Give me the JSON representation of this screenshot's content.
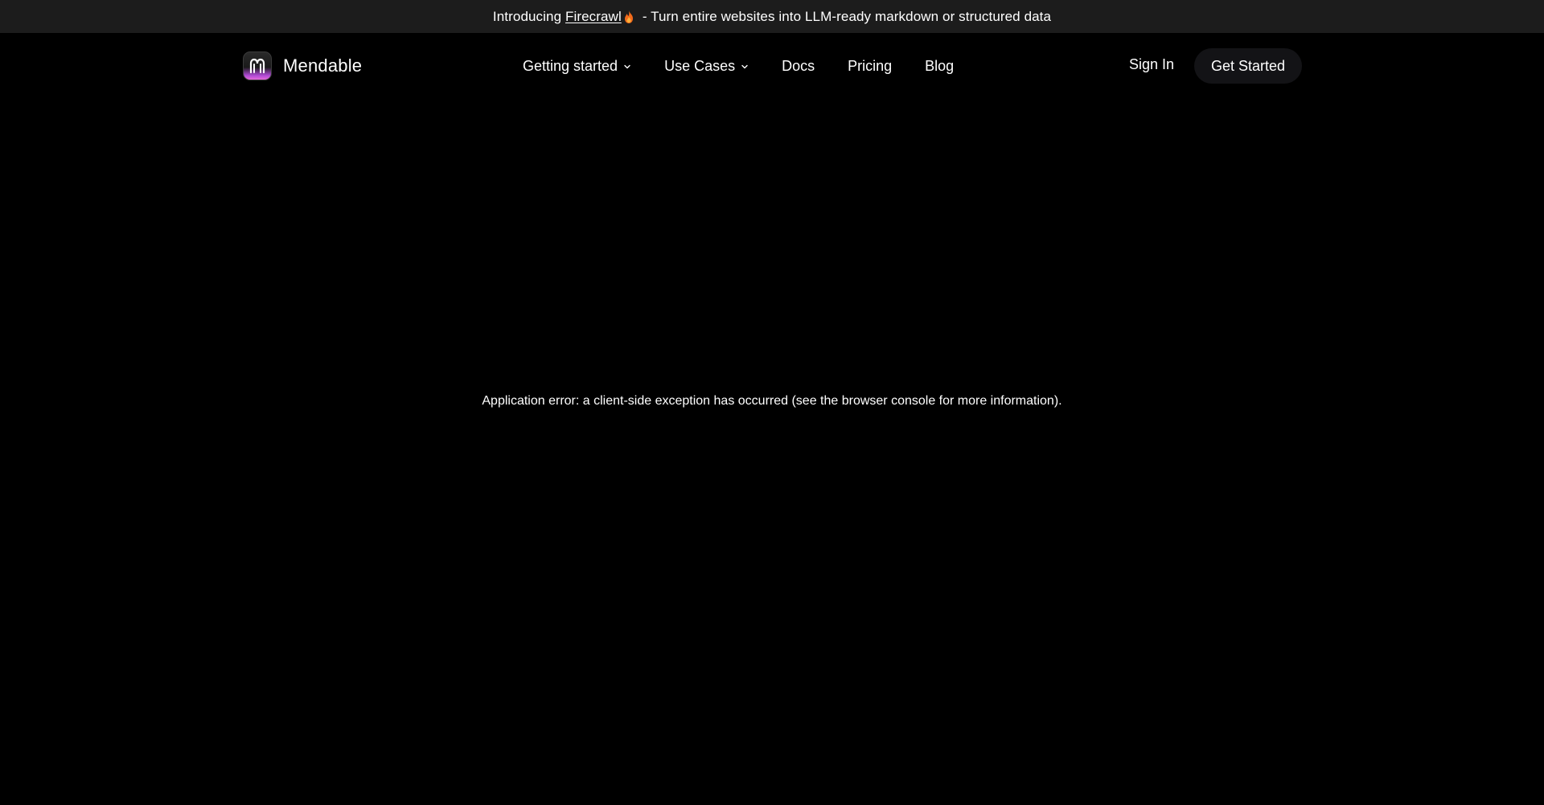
{
  "announcement": {
    "prefix": "Introducing",
    "link_label": "Firecrawl",
    "suffix": "- Turn entire websites into LLM-ready markdown or structured data",
    "icon": "fire-icon"
  },
  "header": {
    "brand_name": "Mendable",
    "logo_icon": "mendable-logo-icon",
    "nav": [
      {
        "label": "Getting started",
        "has_dropdown": true
      },
      {
        "label": "Use Cases",
        "has_dropdown": true
      },
      {
        "label": "Docs",
        "has_dropdown": false
      },
      {
        "label": "Pricing",
        "has_dropdown": false
      },
      {
        "label": "Blog",
        "has_dropdown": false
      }
    ],
    "sign_in_label": "Sign In",
    "get_started_label": "Get Started"
  },
  "main": {
    "error_message": "Application error: a client-side exception has occurred (see the browser console for more information)."
  },
  "colors": {
    "background": "#000000",
    "announcement_bar": "#1c1c1c",
    "button_bg": "#131316",
    "text": "#ffffff",
    "logo_accent": "#b04ad6"
  }
}
